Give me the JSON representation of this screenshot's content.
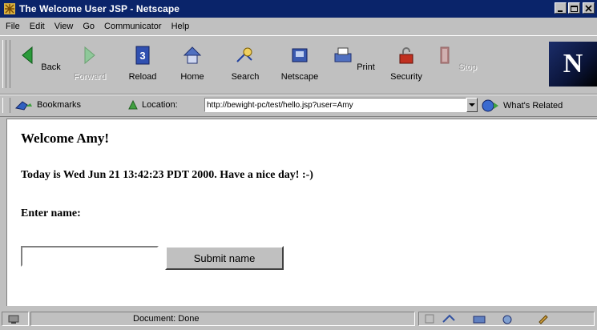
{
  "window": {
    "title": "The Welcome User JSP - Netscape"
  },
  "menu": [
    {
      "label": "File"
    },
    {
      "label": "Edit"
    },
    {
      "label": "View"
    },
    {
      "label": "Go"
    },
    {
      "label": "Communicator"
    },
    {
      "label": "Help"
    }
  ],
  "toolbar": {
    "buttons": [
      {
        "label": "Back",
        "icon": "back-arrow-icon",
        "enabled": true
      },
      {
        "label": "Forward",
        "icon": "forward-arrow-icon",
        "enabled": false
      },
      {
        "label": "Reload",
        "icon": "reload-icon",
        "enabled": true
      },
      {
        "label": "Home",
        "icon": "home-icon",
        "enabled": true
      },
      {
        "label": "Search",
        "icon": "search-icon",
        "enabled": true
      },
      {
        "label": "Netscape",
        "icon": "netscape-icon",
        "enabled": true
      },
      {
        "label": "Print",
        "icon": "print-icon",
        "enabled": true
      },
      {
        "label": "Security",
        "icon": "security-lock-icon",
        "enabled": true
      },
      {
        "label": "Stop",
        "icon": "stop-icon",
        "enabled": false
      }
    ],
    "logo_text": "N"
  },
  "location": {
    "bookmarks_label": "Bookmarks",
    "location_label": "Location:",
    "url": "http://bewight-pc/test/hello.jsp?user=Amy",
    "related_label": "What's Related"
  },
  "page": {
    "welcome": "Welcome Amy!",
    "date_line": "Today is Wed Jun 21 13:42:23 PDT 2000. Have a nice day! :-)",
    "enter_name": "Enter name:",
    "name_value": "",
    "submit_label": "Submit name"
  },
  "status": {
    "text": "Document: Done"
  },
  "colors": {
    "titlebar": "#0a246a",
    "chrome": "#c0c0c0"
  }
}
